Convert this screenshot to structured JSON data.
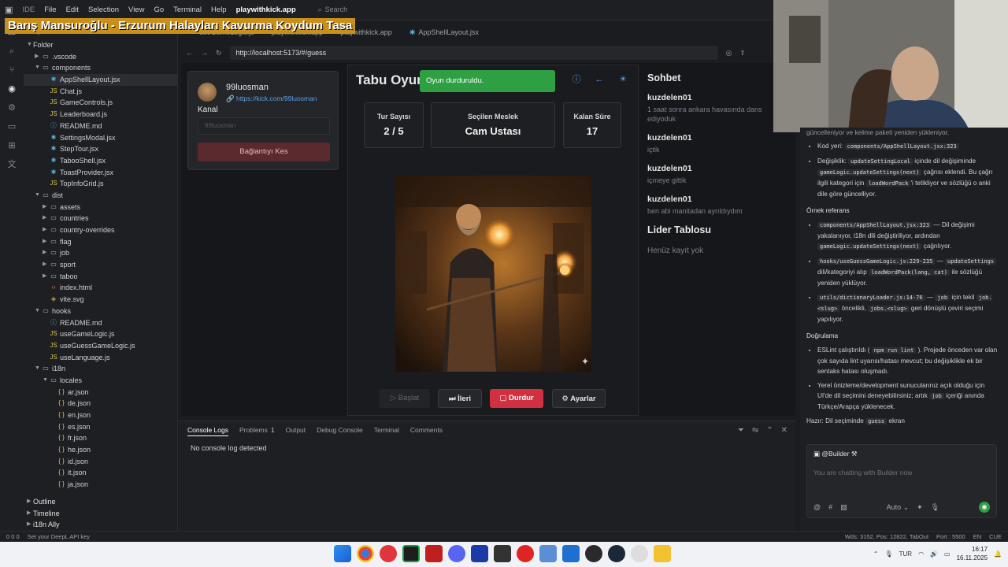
{
  "topbar": {
    "brand": "IDE",
    "menu": [
      "File",
      "Edit",
      "Selection",
      "View",
      "Go",
      "Terminal",
      "Help"
    ],
    "app_title": "playwithkick.app",
    "search_label": "Search"
  },
  "overlay_banner": "Barış Mansuroğlu - Erzurum Halayları Kavurma Koydum Tasa",
  "explorer": {
    "title": "Explorer",
    "root": "Folder",
    "tree": [
      {
        "label": ".vscode",
        "depth": 1,
        "kind": "folder",
        "open": false
      },
      {
        "label": "components",
        "depth": 1,
        "kind": "folder",
        "open": true
      },
      {
        "label": "AppShellLayout.jsx",
        "depth": 2,
        "kind": "react",
        "selected": true
      },
      {
        "label": "Chat.js",
        "depth": 2,
        "kind": "js"
      },
      {
        "label": "GameControls.js",
        "depth": 2,
        "kind": "js"
      },
      {
        "label": "Leaderboard.js",
        "depth": 2,
        "kind": "js"
      },
      {
        "label": "README.md",
        "depth": 2,
        "kind": "info"
      },
      {
        "label": "SettingsModal.jsx",
        "depth": 2,
        "kind": "react"
      },
      {
        "label": "StepTour.jsx",
        "depth": 2,
        "kind": "react"
      },
      {
        "label": "TabooShell.jsx",
        "depth": 2,
        "kind": "react"
      },
      {
        "label": "ToastProvider.jsx",
        "depth": 2,
        "kind": "react"
      },
      {
        "label": "TopInfoGrid.js",
        "depth": 2,
        "kind": "js"
      },
      {
        "label": "dist",
        "depth": 1,
        "kind": "folder",
        "open": true
      },
      {
        "label": "assets",
        "depth": 2,
        "kind": "folder",
        "open": false
      },
      {
        "label": "countries",
        "depth": 2,
        "kind": "folder",
        "open": false
      },
      {
        "label": "country-overrides",
        "depth": 2,
        "kind": "folder",
        "open": false
      },
      {
        "label": "flag",
        "depth": 2,
        "kind": "folder",
        "open": false
      },
      {
        "label": "job",
        "depth": 2,
        "kind": "folder",
        "open": false
      },
      {
        "label": "sport",
        "depth": 2,
        "kind": "folder",
        "open": false
      },
      {
        "label": "taboo",
        "depth": 2,
        "kind": "folder",
        "open": false
      },
      {
        "label": "index.html",
        "depth": 2,
        "kind": "html"
      },
      {
        "label": "vite.svg",
        "depth": 2,
        "kind": "svg"
      },
      {
        "label": "hooks",
        "depth": 1,
        "kind": "folder",
        "open": true
      },
      {
        "label": "README.md",
        "depth": 2,
        "kind": "info"
      },
      {
        "label": "useGameLogic.js",
        "depth": 2,
        "kind": "js"
      },
      {
        "label": "useGuessGameLogic.js",
        "depth": 2,
        "kind": "js"
      },
      {
        "label": "useLanguage.js",
        "depth": 2,
        "kind": "js"
      },
      {
        "label": "i18n",
        "depth": 1,
        "kind": "folder",
        "open": true
      },
      {
        "label": "locales",
        "depth": 2,
        "kind": "folder",
        "open": true
      },
      {
        "label": "ar.json",
        "depth": 3,
        "kind": "json"
      },
      {
        "label": "de.json",
        "depth": 3,
        "kind": "json"
      },
      {
        "label": "en.json",
        "depth": 3,
        "kind": "json"
      },
      {
        "label": "es.json",
        "depth": 3,
        "kind": "json"
      },
      {
        "label": "fr.json",
        "depth": 3,
        "kind": "json"
      },
      {
        "label": "he.json",
        "depth": 3,
        "kind": "json"
      },
      {
        "label": "id.json",
        "depth": 3,
        "kind": "json"
      },
      {
        "label": "it.json",
        "depth": 3,
        "kind": "json"
      },
      {
        "label": "ja.json",
        "depth": 3,
        "kind": "json"
      }
    ],
    "bottom_sections": [
      "Outline",
      "Timeline",
      "i18n Ally"
    ]
  },
  "editor_tabs": [
    "useGameLogic.js",
    "playwithkick.app",
    "playwithkick.app",
    "AppShellLayout.jsx"
  ],
  "url": "http://localhost:5173/#/guess",
  "game": {
    "channel_name": "99luosman",
    "channel_link": "https://kick.com/99luosman",
    "kanal_label": "Kanal",
    "kanal_placeholder": "99luosman",
    "disconnect_label": "Bağlantıyı Kes",
    "title": "Tabu Oyun",
    "toast": "Oyun durduruldu.",
    "stats": [
      {
        "label": "Tur Sayısı",
        "value": "2 / 5"
      },
      {
        "label": "Seçilen Meslek",
        "value": "Cam Ustası"
      },
      {
        "label": "Kalan Süre",
        "value": "17"
      }
    ],
    "buttons": {
      "start": "Başlat",
      "next": "İleri",
      "stop": "Durdur",
      "settings": "Ayarlar"
    }
  },
  "chat": {
    "title": "Sohbet",
    "messages": [
      {
        "user": "kuzdelen01",
        "text": "1 saat sonra ankara havasında dans ediyoduk"
      },
      {
        "user": "kuzdelen01",
        "text": "içtik"
      },
      {
        "user": "kuzdelen01",
        "text": "içmeye gittik"
      },
      {
        "user": "kuzdelen01",
        "text": "ben abi manitadan ayrıldıydım"
      }
    ]
  },
  "leaderboard": {
    "title": "Lider Tablosu",
    "empty": "Henüz kayıt yok"
  },
  "console": {
    "tabs": [
      "Console Logs",
      "Problems",
      "Output",
      "Debug Console",
      "Terminal",
      "Comments"
    ],
    "problems_count": "1",
    "message": "No console log detected"
  },
  "right_pane": {
    "intro": "güncelleniyor ve kelime paketi yeniden yükleniyor.",
    "code_file_label": "Kod yeri:",
    "code_file": "components/AppShellLayout.jsx:323",
    "change_label": "Değişiklik:",
    "change_fn": "updateSettingLocal",
    "change_text1": "içinde dil değişiminde",
    "change_call": "gameLogic.updateSettings(next)",
    "change_text2": "çağrısı eklendi. Bu çağrı ilgili kategori için",
    "change_load": "loadWordPack",
    "change_text3": "'i tetikliyor ve sözlüğü o anki dile göre güncelliyor.",
    "ref_title": "Örnek referans",
    "ref1_code": "components/AppShellLayout.jsx:323",
    "ref1_text": "— Dil değişimi yakalanıyor, i18n dili değiştiriliyor, ardından",
    "ref1_call": "gameLogic.updateSettings(next)",
    "ref1_tail": "çağrılıyor.",
    "ref2_code": "hooks/useGuessGameLogic.js:229-235",
    "ref2_call": "updateSettings",
    "ref2_text": "dili/kategoriyi alıp",
    "ref2_load": "loadWordPack(lang, cat)",
    "ref2_tail": "ile sözlüğü yeniden yüklüyor.",
    "ref3_code": "utils/dictionaryLoader.js:14-76",
    "ref3_job": "job",
    "ref3_text": "için tekil",
    "ref3_slug": "job.<slug>",
    "ref3_text2": "öncelikli,",
    "ref3_slugs": "jobs.<slug>",
    "ref3_tail": "geri dönüşlü çeviri seçimi yapılıyor.",
    "verify_title": "Doğrulama",
    "v1_a": "ESLint çalıştırıldı (",
    "v1_code": "npm run lint",
    "v1_b": "). Projede önceden var olan çok sayıda lint uyarısı/hatası mevcut; bu değişiklikle ek bir sentaks hatası oluşmadı.",
    "v2_a": "Yerel önizleme/development sunucularınız açık olduğu için UI'de dil seçimini deneyebilirsiniz; artık",
    "v2_code": "job",
    "v2_b": "içeriği anında Türkçe/Arapça yüklenecek.",
    "ready_a": "Hazır: Dil seçiminde",
    "ready_code": "guess",
    "ready_b": "ekran"
  },
  "builder": {
    "handle": "@Builder",
    "placeholder": "You are chatting with Builder now",
    "mode": "Auto"
  },
  "statusbar": {
    "left": "Set your DeepL API key",
    "counts": "0  0  0",
    "right": [
      "Wds: 3152, Pos: 12822, TabOut",
      "Port : 5500",
      "EN",
      "CUE"
    ]
  },
  "taskbar": {
    "lang": "TUR",
    "time": "16:17",
    "date": "16.11.2025"
  },
  "colors": {
    "toast": "#2ea043",
    "stop": "#d0303f",
    "link": "#5aa0e6",
    "banner": "#c88f1a"
  }
}
